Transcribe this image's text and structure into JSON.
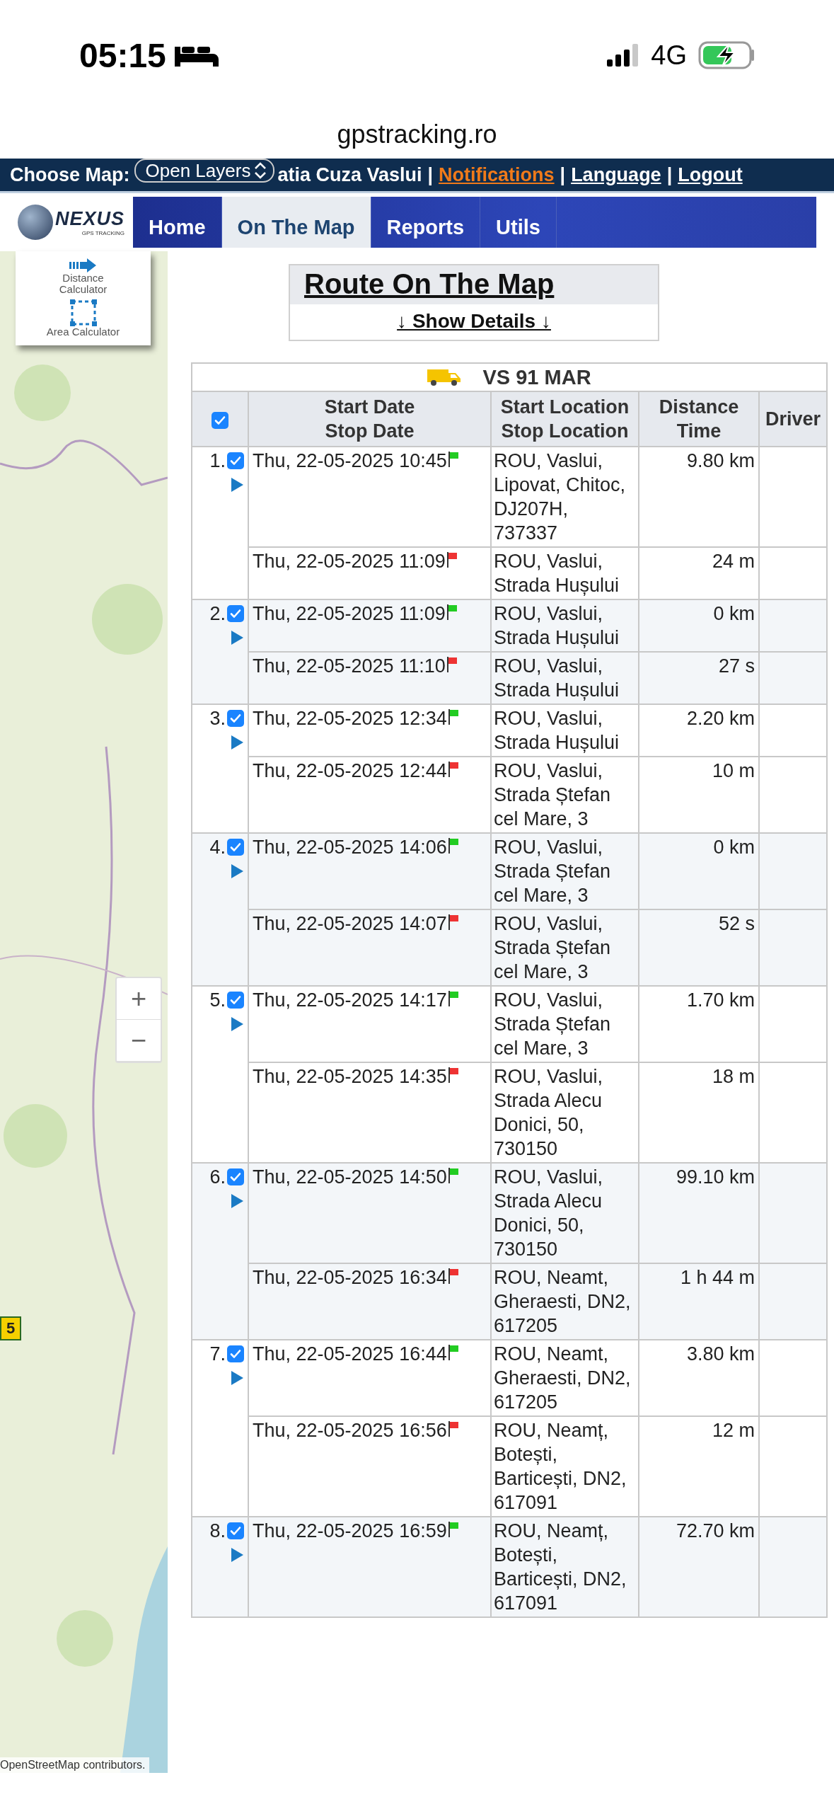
{
  "status_bar": {
    "time": "05:15",
    "network": "4G"
  },
  "url": "gpstracking.ro",
  "top_bar": {
    "label": "Choose Map:",
    "map_select": "Open Layers",
    "items": [
      {
        "kind": "text",
        "text": "atia Cuza Vaslui"
      },
      {
        "kind": "separator",
        "text": "|"
      },
      {
        "kind": "link",
        "text": "Notifications",
        "highlighted": true
      },
      {
        "kind": "separator",
        "text": "|"
      },
      {
        "kind": "link",
        "text": "Language",
        "highlighted": false
      },
      {
        "kind": "separator",
        "text": "|"
      },
      {
        "kind": "link",
        "text": "Logout",
        "highlighted": false
      }
    ]
  },
  "logo": {
    "name": "NEXUS",
    "tagline": "GPS TRACKING"
  },
  "tabs": [
    {
      "label": "Home",
      "selected": false
    },
    {
      "label": "On The Map",
      "selected": true
    },
    {
      "label": "Reports",
      "selected": false
    },
    {
      "label": "Utils",
      "selected": false
    }
  ],
  "map_tools": [
    {
      "kind": "distance",
      "label": "Distance Calculator"
    },
    {
      "kind": "area",
      "label": "Area Calculator"
    }
  ],
  "map": {
    "zoom_in": "+",
    "zoom_out": "−",
    "marker": "5",
    "attribution": "OpenStreetMap contributors."
  },
  "route": {
    "title": "Route On The Map",
    "toggle": "↓ Show Details ↓"
  },
  "table": {
    "vehicle": "VS 91 MAR",
    "all_checked": true,
    "columns": [
      {
        "lines": [
          "Start Date",
          "Stop Date"
        ]
      },
      {
        "lines": [
          "Start Location",
          "Stop Location"
        ]
      },
      {
        "lines": [
          "Distance",
          "Time"
        ]
      },
      {
        "lines": [
          "Driver"
        ]
      }
    ],
    "trips": [
      {
        "number": "1.",
        "checked": true,
        "start": {
          "date": "Thu, 22-05-2025 10:45",
          "location": "ROU, Vaslui, Lipovat, Chitoc, DJ207H, 737337",
          "value": "9.80 km"
        },
        "stop": {
          "date": "Thu, 22-05-2025 11:09",
          "location": "ROU, Vaslui, Strada Hușului",
          "value": "24 m"
        }
      },
      {
        "number": "2.",
        "checked": true,
        "start": {
          "date": "Thu, 22-05-2025 11:09",
          "location": "ROU, Vaslui, Strada Hușului",
          "value": "0 km"
        },
        "stop": {
          "date": "Thu, 22-05-2025 11:10",
          "location": "ROU, Vaslui, Strada Hușului",
          "value": "27 s"
        }
      },
      {
        "number": "3.",
        "checked": true,
        "start": {
          "date": "Thu, 22-05-2025 12:34",
          "location": "ROU, Vaslui, Strada Hușului",
          "value": "2.20 km"
        },
        "stop": {
          "date": "Thu, 22-05-2025 12:44",
          "location": "ROU, Vaslui, Strada Ștefan cel Mare, 3",
          "value": "10 m"
        }
      },
      {
        "number": "4.",
        "checked": true,
        "start": {
          "date": "Thu, 22-05-2025 14:06",
          "location": "ROU, Vaslui, Strada Ștefan cel Mare, 3",
          "value": "0 km"
        },
        "stop": {
          "date": "Thu, 22-05-2025 14:07",
          "location": "ROU, Vaslui, Strada Ștefan cel Mare, 3",
          "value": "52 s"
        }
      },
      {
        "number": "5.",
        "checked": true,
        "start": {
          "date": "Thu, 22-05-2025 14:17",
          "location": "ROU, Vaslui, Strada Ștefan cel Mare, 3",
          "value": "1.70 km"
        },
        "stop": {
          "date": "Thu, 22-05-2025 14:35",
          "location": "ROU, Vaslui, Strada Alecu Donici, 50, 730150",
          "value": "18 m"
        }
      },
      {
        "number": "6.",
        "checked": true,
        "start": {
          "date": "Thu, 22-05-2025 14:50",
          "location": "ROU, Vaslui, Strada Alecu Donici, 50, 730150",
          "value": "99.10 km"
        },
        "stop": {
          "date": "Thu, 22-05-2025 16:34",
          "location": "ROU, Neamt, Gheraesti, DN2, 617205",
          "value": "1 h 44 m"
        }
      },
      {
        "number": "7.",
        "checked": true,
        "start": {
          "date": "Thu, 22-05-2025 16:44",
          "location": "ROU, Neamt, Gheraesti, DN2, 617205",
          "value": "3.80 km"
        },
        "stop": {
          "date": "Thu, 22-05-2025 16:56",
          "location": "ROU, Neamț, Botești, Barticești, DN2, 617091",
          "value": "12 m"
        }
      },
      {
        "number": "8.",
        "checked": true,
        "start": {
          "date": "Thu, 22-05-2025 16:59",
          "location": "ROU, Neamț, Botești, Barticești, DN2, 617091",
          "value": "72.70 km"
        }
      }
    ]
  }
}
